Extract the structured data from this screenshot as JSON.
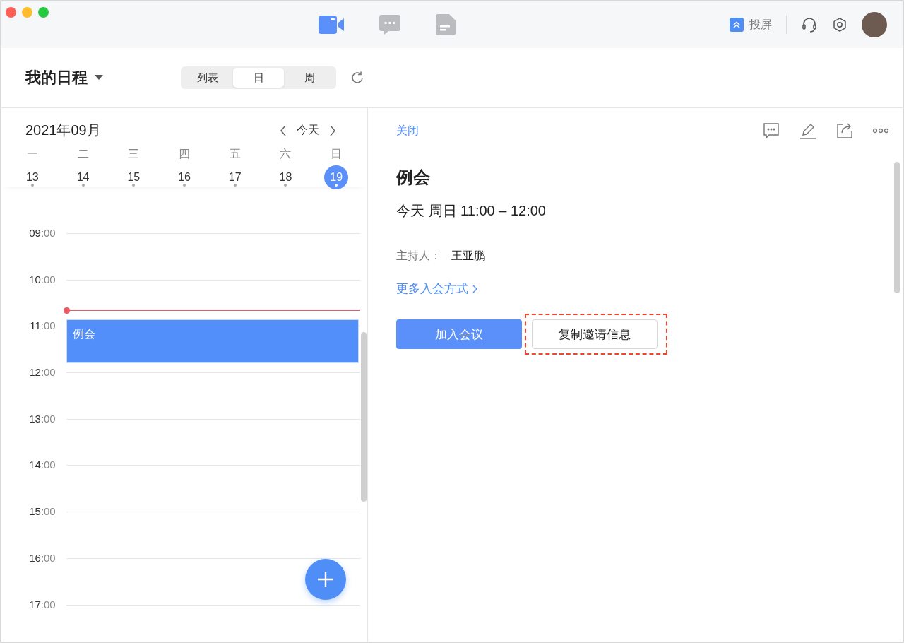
{
  "toolbar": {
    "tabs": [
      {
        "kind": "video",
        "selected": true
      },
      {
        "kind": "chat",
        "selected": false
      },
      {
        "kind": "doc",
        "selected": false
      }
    ],
    "cast_label": "投屏"
  },
  "header": {
    "title": "我的日程",
    "views": [
      {
        "label": "列表",
        "selected": false
      },
      {
        "label": "日",
        "selected": true
      },
      {
        "label": "周",
        "selected": false
      }
    ]
  },
  "calendar": {
    "month": "2021年09月",
    "today_label": "今天",
    "days": [
      {
        "weekday": "一",
        "date": "13",
        "selected": false
      },
      {
        "weekday": "二",
        "date": "14",
        "selected": false
      },
      {
        "weekday": "三",
        "date": "15",
        "selected": false
      },
      {
        "weekday": "四",
        "date": "16",
        "selected": false
      },
      {
        "weekday": "五",
        "date": "17",
        "selected": false
      },
      {
        "weekday": "六",
        "date": "18",
        "selected": false
      },
      {
        "weekday": "日",
        "date": "19",
        "selected": true
      }
    ],
    "hours": [
      {
        "hour": "09:",
        "minute": "00",
        "now_line": false
      },
      {
        "hour": "10:",
        "minute": "00",
        "now_line": false
      },
      {
        "hour": "11:",
        "minute": "00",
        "now_line": true,
        "event": "例会"
      },
      {
        "hour": "12:",
        "minute": "00",
        "now_line": false
      },
      {
        "hour": "13:",
        "minute": "00",
        "now_line": false
      },
      {
        "hour": "14:",
        "minute": "00",
        "now_line": false
      },
      {
        "hour": "15:",
        "minute": "00",
        "now_line": false
      },
      {
        "hour": "16:",
        "minute": "00",
        "now_line": false
      },
      {
        "hour": "17:",
        "minute": "00",
        "now_line": false
      }
    ]
  },
  "detail": {
    "close": "关闭",
    "title": "例会",
    "time": "今天 周日 11:00 – 12:00",
    "host_label": "主持人：",
    "host": "王亚鹏",
    "more_link": "更多入会方式",
    "join_button": "加入会议",
    "copy_button": "复制邀请信息"
  }
}
